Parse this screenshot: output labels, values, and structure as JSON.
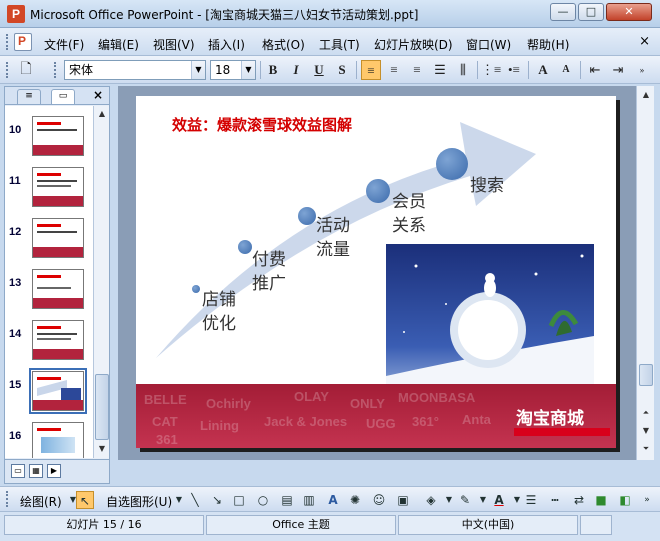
{
  "window": {
    "title": "Microsoft Office PowerPoint - [淘宝商城天猫三八妇女节活动策划.ppt]",
    "app_icon": "powerpoint-icon",
    "minimize_glyph": "—",
    "maximize_glyph": "□",
    "close_glyph": "✕"
  },
  "menu": {
    "items": [
      "文件(F)",
      "编辑(E)",
      "视图(V)",
      "插入(I)",
      "格式(O)",
      "工具(T)",
      "幻灯片放映(D)",
      "窗口(W)",
      "帮助(H)"
    ],
    "close_glyph": "×"
  },
  "toolbar": {
    "font_name": "宋体",
    "font_size": "18",
    "bold": "B",
    "italic": "I",
    "underline": "U",
    "shadow": "S",
    "align_left_active": true,
    "grow_font": "A",
    "shrink_font": "A"
  },
  "sidebar": {
    "close_glyph": "×",
    "slides": [
      {
        "number": "10"
      },
      {
        "number": "11"
      },
      {
        "number": "12"
      },
      {
        "number": "13"
      },
      {
        "number": "14"
      },
      {
        "number": "15",
        "selected": true
      },
      {
        "number": "16"
      }
    ]
  },
  "slide": {
    "title": "效益：爆款滚雪球效益图解",
    "steps": [
      {
        "label_line1": "店铺",
        "label_line2": "优化"
      },
      {
        "label_line1": "付费",
        "label_line2": "推广"
      },
      {
        "label_line1": "活动",
        "label_line2": "流量"
      },
      {
        "label_line1": "会员",
        "label_line2": "关系"
      },
      {
        "label_line1": "搜索",
        "label_line2": ""
      }
    ],
    "brand": "淘宝商城",
    "band_logos": [
      "BELLE",
      "Ochirly",
      "OLAY",
      "ONLY",
      "MOONBASA",
      "CAT",
      "Lining",
      "Jack & Jones",
      "UGG",
      "361°",
      "Anta",
      "361"
    ],
    "colors": {
      "title": "#d40000",
      "band": "#b2233d",
      "dot": "#3b6aab",
      "arrow": "#c9d6ea"
    }
  },
  "drawing_toolbar": {
    "draw_label": "绘图(R)",
    "autoshapes_label": "自选图形(U)"
  },
  "status": {
    "slide_info": "幻灯片 15 / 16",
    "theme": "Office 主题",
    "language": "中文(中国)"
  }
}
